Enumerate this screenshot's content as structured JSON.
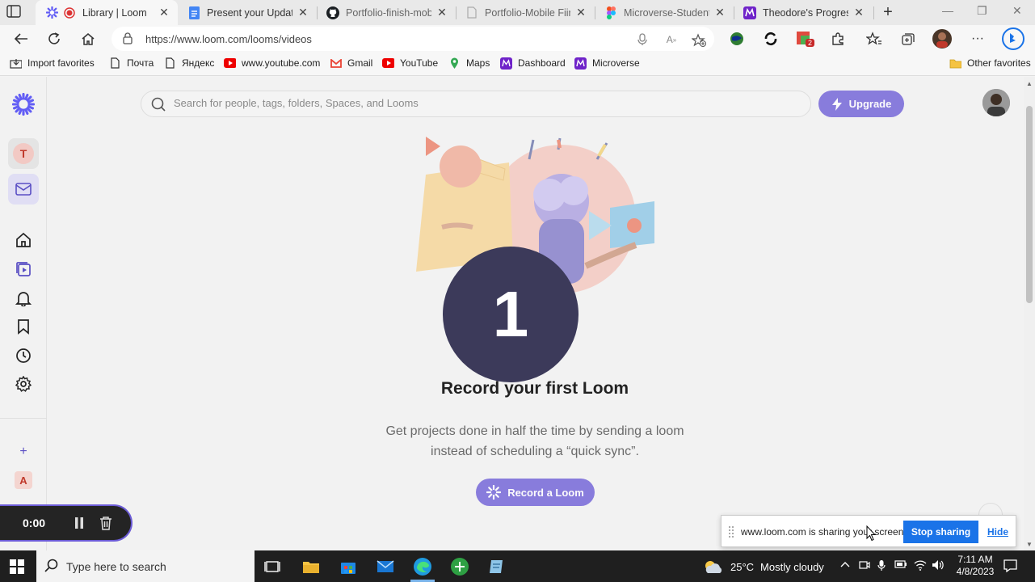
{
  "browser": {
    "tabs": [
      {
        "title": "Library | Loom",
        "active": true
      },
      {
        "title": "Present your Updated",
        "active": false
      },
      {
        "title": "Portfolio-finish-mobile",
        "active": false
      },
      {
        "title": "Portfolio-Mobile Fiirst",
        "active": false
      },
      {
        "title": "Microverse-Student-P",
        "active": false
      },
      {
        "title": "Theodore's Progress",
        "active": false
      }
    ],
    "url": "https://www.loom.com/looms/videos",
    "favorites": [
      "Import favorites",
      "Почта",
      "Яндекс",
      "www.youtube.com",
      "Gmail",
      "YouTube",
      "Maps",
      "Dashboard",
      "Microverse"
    ],
    "other_favorites": "Other favorites",
    "extension_badge": "2"
  },
  "loom": {
    "sidebar": {
      "workspace_initial": "T",
      "bottom_initial": "A",
      "add_label": "+"
    },
    "search_placeholder": "Search for people, tags, folders, Spaces, and Looms",
    "upgrade_label": "Upgrade",
    "countdown": "1",
    "empty_title": "Record your first Loom",
    "empty_desc_line1": "Get projects done in half the time by sending a loom",
    "empty_desc_line2": "instead of scheduling a “quick sync”.",
    "record_label": "Record a Loom",
    "recorder_time": "0:00"
  },
  "sharing": {
    "message": "www.loom.com is sharing your screen.",
    "stop_label": "Stop sharing",
    "hide_label": "Hide"
  },
  "taskbar": {
    "search_label": "Type here to search",
    "temperature": "25°C",
    "weather": "Mostly cloudy",
    "time": "7:11 AM",
    "date": "4/8/2023"
  },
  "colors": {
    "loom_purple": "#6b5bd6",
    "countdown_bg": "#3c3a5a",
    "edge_blue": "#1a73e8"
  }
}
